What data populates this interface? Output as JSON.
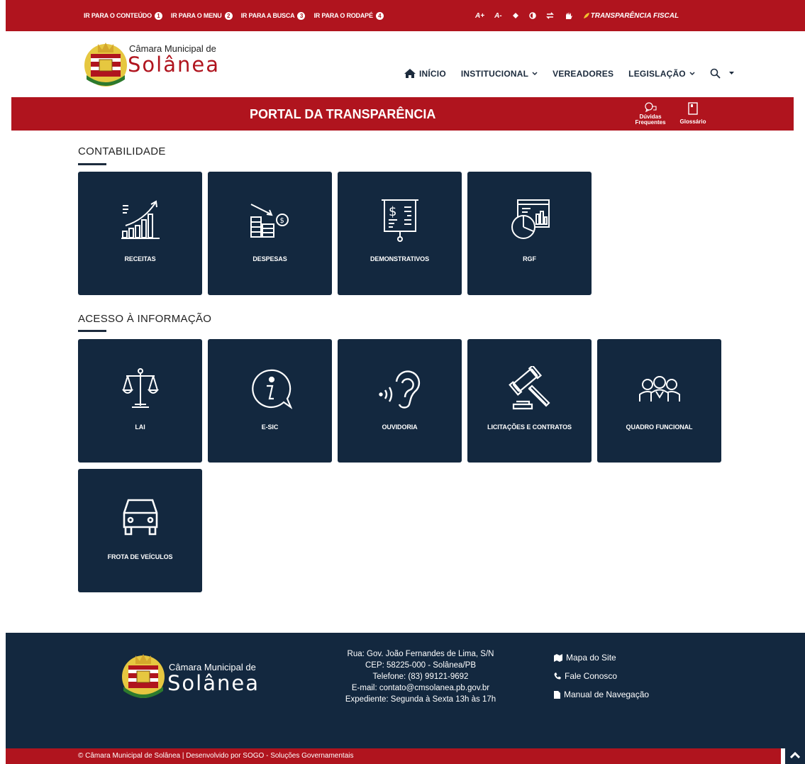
{
  "topbar": {
    "skip_links": [
      {
        "label": "IR PARA O CONTEÚDO",
        "num": "1"
      },
      {
        "label": "IR PARA O MENU",
        "num": "2"
      },
      {
        "label": "IR PARA A BUSCA",
        "num": "3"
      },
      {
        "label": "IR PARA O RODAPÉ",
        "num": "4"
      }
    ],
    "font_increase": "A+",
    "font_decrease": "A-",
    "transparency_link": "TRANSPARÊNCIA FISCAL"
  },
  "header": {
    "logo_small": "Câmara Municipal de",
    "logo_big": "Solânea",
    "nav": {
      "inicio": "INÍCIO",
      "institucional": "INSTITUCIONAL",
      "vereadores": "VEREADORES",
      "legislacao": "LEGISLAÇÃO"
    }
  },
  "banner": {
    "title": "PORTAL DA TRANSPARÊNCIA",
    "faq_line1": "Dúvidas",
    "faq_line2": "Frequentes",
    "glossary": "Glossário"
  },
  "sections": {
    "contabilidade": {
      "title": "CONTABILIDADE",
      "cards": [
        "RECEITAS",
        "DESPESAS",
        "DEMONSTRATIVOS",
        "RGF"
      ]
    },
    "acesso": {
      "title": "ACESSO À INFORMAÇÃO",
      "cards": [
        "LAI",
        "E-SIC",
        "OUVIDORIA",
        "LICITAÇÕES E CONTRATOS",
        "QUADRO FUNCIONAL",
        "FROTA DE VEÍCULOS"
      ]
    }
  },
  "footer": {
    "logo_small": "Câmara Municipal de",
    "logo_big": "Solânea",
    "address": [
      "Rua: Gov. João Fernandes de Lima, S/N",
      "CEP: 58225-000 - Solânea/PB",
      "Telefone: (83) 99121-9692",
      "E-mail: contato@cmsolanea.pb.gov.br",
      "Expediente: Segunda à Sexta 13h às 17h"
    ],
    "links": {
      "sitemap": "Mapa do Site",
      "contact": "Fale Conosco",
      "manual": "Manual de Navegação"
    },
    "copyright": "© Câmara Municipal de Solânea | Desenvolvido por SOGO - Soluções Governamentais"
  },
  "colors": {
    "brand_red": "#b0141e",
    "navy": "#13283f"
  }
}
